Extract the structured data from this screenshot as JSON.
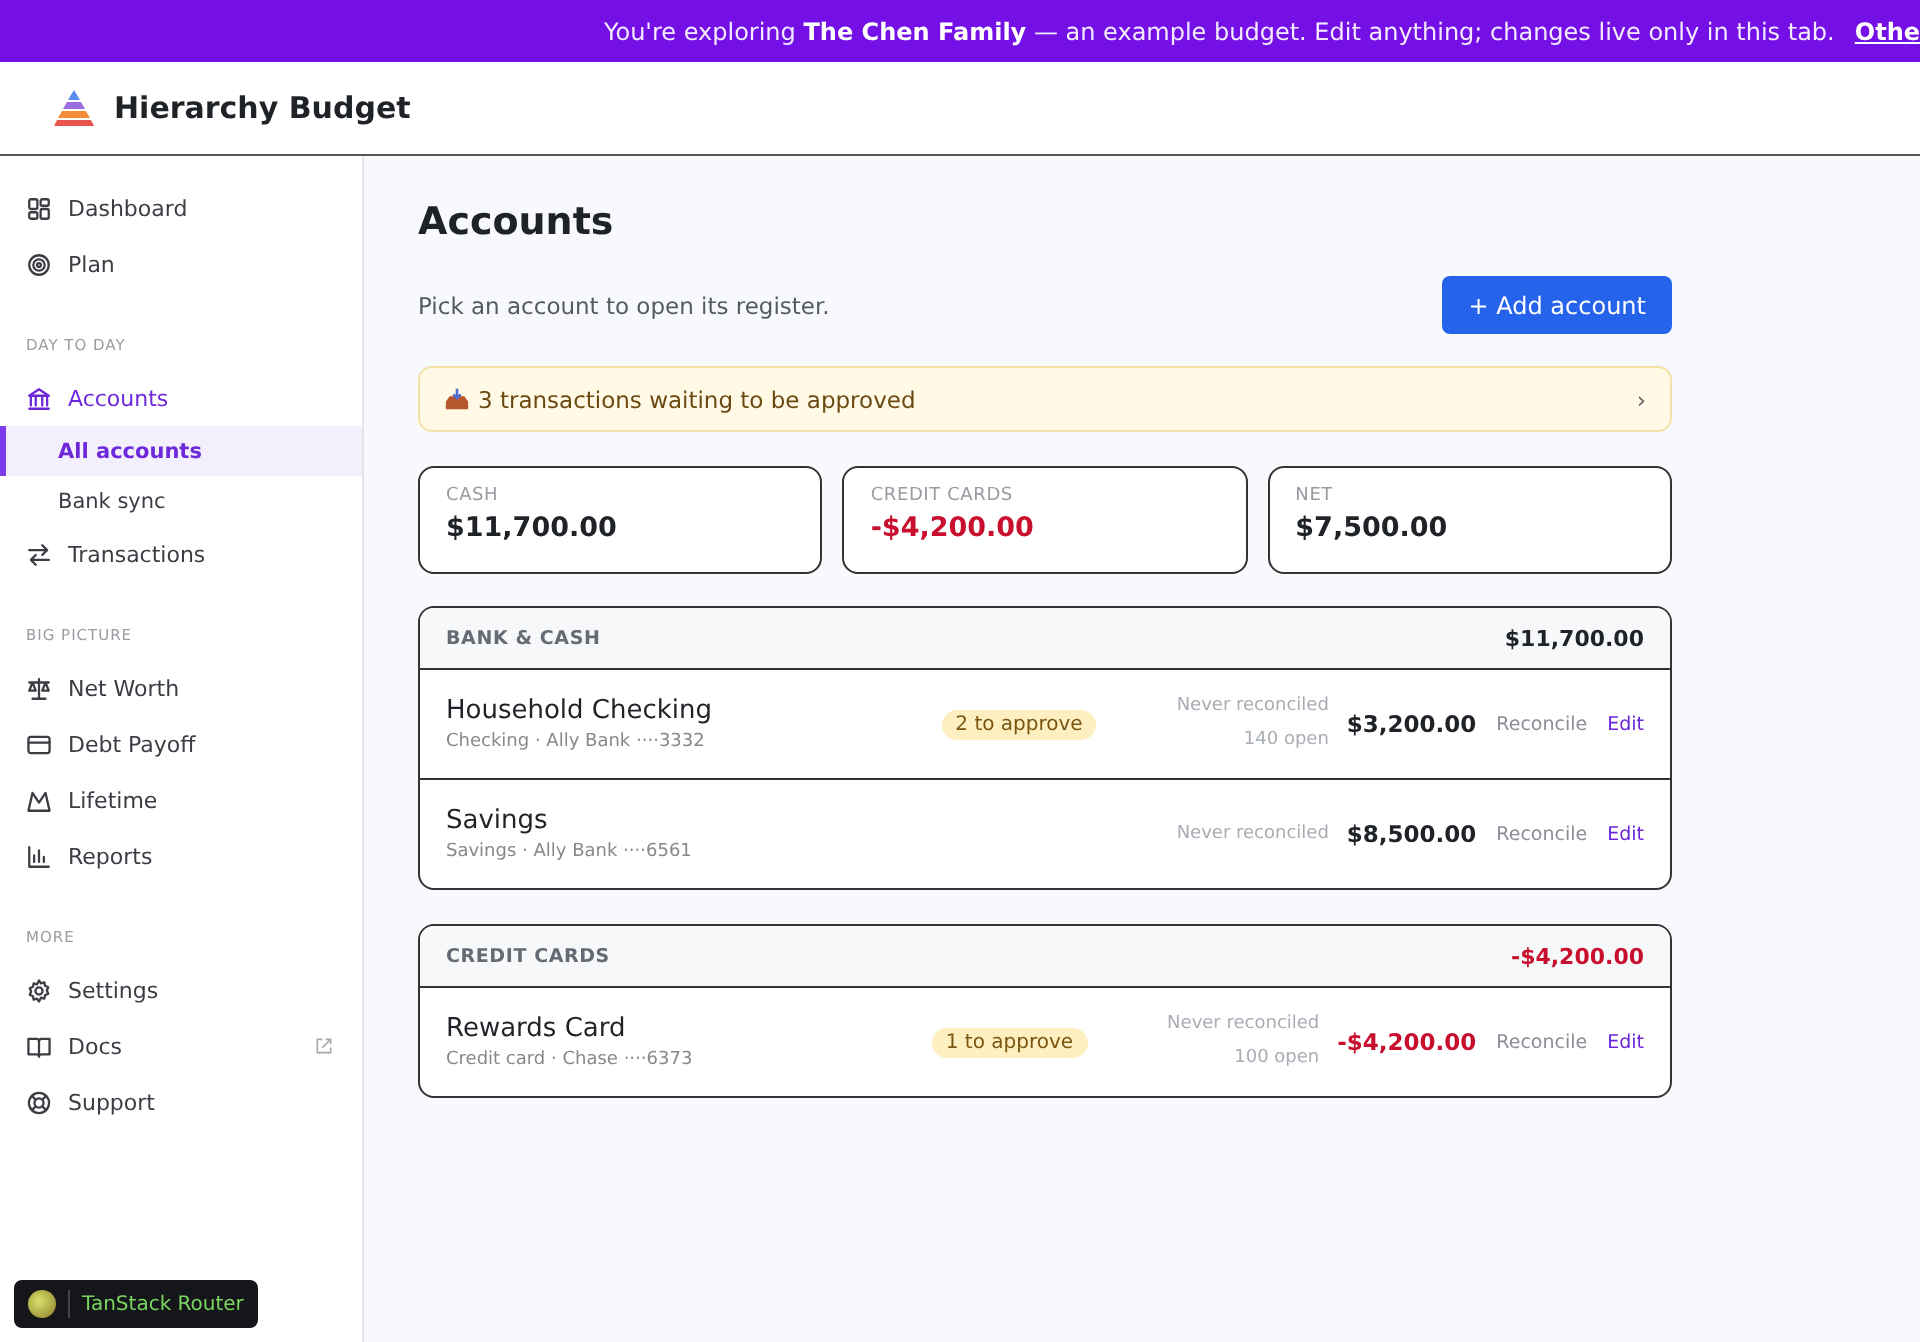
{
  "banner": {
    "text": "You're exploring **The Chen Family** — an example budget. Edit anything; changes live only in this tab.",
    "link": "Othe"
  },
  "header": {
    "app_name": "Hierarchy Budget"
  },
  "sidebar": {
    "sections": [
      {
        "items": [
          {
            "label": "Dashboard",
            "selected": false
          },
          {
            "label": "Plan",
            "selected": false
          }
        ]
      },
      {
        "heading": "DAY TO DAY",
        "items": [
          {
            "label": "Accounts",
            "selected": true,
            "children": [
              {
                "label": "All accounts",
                "selected": true
              },
              {
                "label": "Bank sync",
                "selected": false
              }
            ]
          },
          {
            "label": "Transactions",
            "selected": false
          }
        ]
      },
      {
        "heading": "BIG PICTURE",
        "items": [
          {
            "label": "Net Worth",
            "selected": false
          },
          {
            "label": "Debt Payoff",
            "selected": false
          },
          {
            "label": "Lifetime",
            "selected": false
          },
          {
            "label": "Reports",
            "selected": false
          }
        ]
      },
      {
        "heading": "MORE",
        "items": [
          {
            "label": "Settings",
            "selected": false
          },
          {
            "label": "Docs",
            "selected": false,
            "external": true
          },
          {
            "label": "Support",
            "selected": false
          }
        ]
      }
    ]
  },
  "devtools_badge": {
    "label": "TanStack Router"
  },
  "page": {
    "title": "Accounts",
    "subtitle": "Pick an account to open its register.",
    "add_button": "+ Add account",
    "approval_notice": {
      "text": "3 transactions waiting to be approved",
      "chevron": "›"
    },
    "summary": [
      {
        "label": "CASH",
        "amount": "$11,700.00",
        "negative": false
      },
      {
        "label": "CREDIT CARDS",
        "amount": "-$4,200.00",
        "negative": true
      },
      {
        "label": "NET",
        "amount": "$7,500.00",
        "negative": false
      }
    ],
    "groups": [
      {
        "name": "BANK & CASH",
        "total": "$11,700.00",
        "negative": false,
        "accounts": [
          {
            "name": "Household Checking",
            "detail": "Checking · Ally Bank ····3332",
            "approve": "2 to approve",
            "reconciled": "Never reconciled",
            "open": "140 open",
            "balance": "$3,200.00",
            "negative": false,
            "reconcile": "Reconcile",
            "edit": "Edit"
          },
          {
            "name": "Savings",
            "detail": "Savings · Ally Bank ····6561",
            "reconciled": "Never reconciled",
            "balance": "$8,500.00",
            "negative": false,
            "reconcile": "Reconcile",
            "edit": "Edit"
          }
        ]
      },
      {
        "name": "CREDIT CARDS",
        "total": "-$4,200.00",
        "negative": true,
        "accounts": [
          {
            "name": "Rewards Card",
            "detail": "Credit card · Chase ····6373",
            "approve": "1 to approve",
            "reconciled": "Never reconciled",
            "open": "100 open",
            "balance": "-$4,200.00",
            "negative": true,
            "reconcile": "Reconcile",
            "edit": "Edit"
          }
        ]
      }
    ]
  }
}
